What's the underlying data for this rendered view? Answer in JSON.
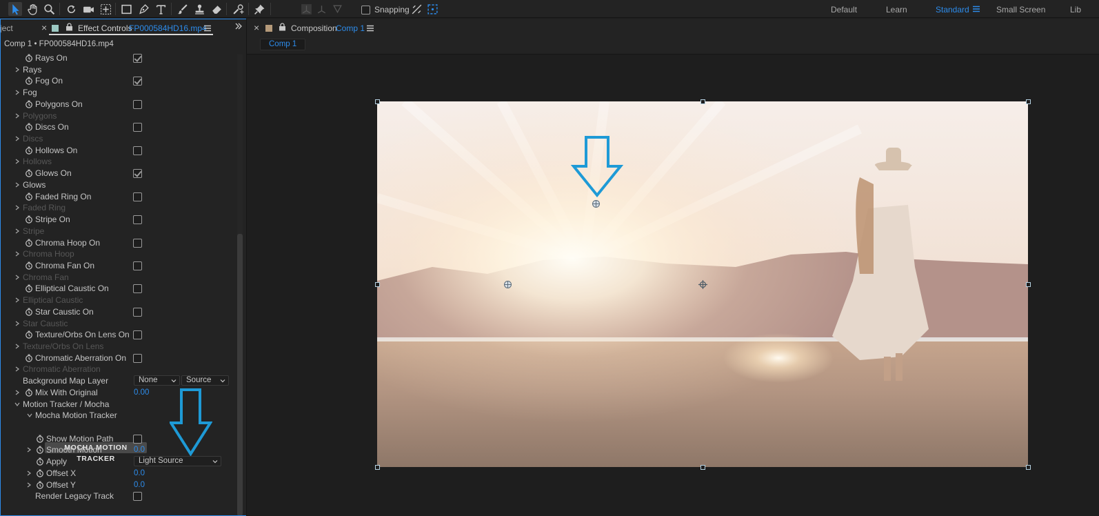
{
  "toolbar": {
    "tools": [
      "selection-tool",
      "hand-tool",
      "zoom-tool",
      "rotate-tool",
      "camera-tool",
      "pan-behind-tool",
      "rectangle-tool",
      "pen-tool",
      "type-tool",
      "brush-tool",
      "clone-stamp-tool",
      "eraser-tool",
      "roto-brush-tool",
      "puppet-pin-tool"
    ],
    "snapping_label": "Snapping",
    "snapping_checked": false,
    "workspaces": [
      "Default",
      "Learn",
      "Standard",
      "Small Screen",
      "Lib"
    ],
    "active_workspace": "Standard"
  },
  "effect_panel": {
    "project_tab_fragment": "ject",
    "tab_label": "Effect Controls",
    "tab_file": "FP000584HD16.mp4",
    "subheader": "Comp 1 • FP000584HD16.mp4",
    "rows": [
      {
        "label": "Rays On",
        "kind": "checkbox",
        "checked": true
      },
      {
        "label": "Rays",
        "kind": "group",
        "dim": false
      },
      {
        "label": "Fog On",
        "kind": "checkbox",
        "checked": true
      },
      {
        "label": "Fog",
        "kind": "group",
        "dim": false
      },
      {
        "label": "Polygons On",
        "kind": "checkbox",
        "checked": false
      },
      {
        "label": "Polygons",
        "kind": "group",
        "dim": true
      },
      {
        "label": "Discs On",
        "kind": "checkbox",
        "checked": false
      },
      {
        "label": "Discs",
        "kind": "group",
        "dim": true
      },
      {
        "label": "Hollows On",
        "kind": "checkbox",
        "checked": false
      },
      {
        "label": "Hollows",
        "kind": "group",
        "dim": true
      },
      {
        "label": "Glows On",
        "kind": "checkbox",
        "checked": true
      },
      {
        "label": "Glows",
        "kind": "group",
        "dim": false
      },
      {
        "label": "Faded Ring On",
        "kind": "checkbox",
        "checked": false
      },
      {
        "label": "Faded Ring",
        "kind": "group",
        "dim": true
      },
      {
        "label": "Stripe On",
        "kind": "checkbox",
        "checked": false
      },
      {
        "label": "Stripe",
        "kind": "group",
        "dim": true
      },
      {
        "label": "Chroma Hoop On",
        "kind": "checkbox",
        "checked": false
      },
      {
        "label": "Chroma Hoop",
        "kind": "group",
        "dim": true
      },
      {
        "label": "Chroma Fan On",
        "kind": "checkbox",
        "checked": false
      },
      {
        "label": "Chroma Fan",
        "kind": "group",
        "dim": true
      },
      {
        "label": "Elliptical Caustic On",
        "kind": "checkbox",
        "checked": false
      },
      {
        "label": "Elliptical Caustic",
        "kind": "group",
        "dim": true
      },
      {
        "label": "Star Caustic On",
        "kind": "checkbox",
        "checked": false
      },
      {
        "label": "Star Caustic",
        "kind": "group",
        "dim": true
      },
      {
        "label": "Texture/Orbs On Lens On",
        "kind": "checkbox",
        "checked": false
      },
      {
        "label": "Texture/Orbs On Lens",
        "kind": "group",
        "dim": true
      },
      {
        "label": "Chromatic Aberration On",
        "kind": "checkbox",
        "checked": false
      },
      {
        "label": "Chromatic Aberration",
        "kind": "group",
        "dim": true
      }
    ],
    "background_map_layer": {
      "label": "Background Map Layer",
      "layer": "None",
      "source": "Source"
    },
    "mix_with_original": {
      "label": "Mix With Original",
      "value": "0.00"
    },
    "motion_tracker_group": "Motion Tracker / Mocha",
    "mocha_group": "Mocha Motion Tracker",
    "mocha_button": "MOCHA MOTION TRACKER",
    "show_motion_path": {
      "label": "Show Motion Path",
      "checked": false
    },
    "smooth_motion": {
      "label": "Smooth Motion",
      "value": "0.0"
    },
    "apply": {
      "label": "Apply",
      "value": "Light Source"
    },
    "offset_x": {
      "label": "Offset X",
      "value": "0.0"
    },
    "offset_y": {
      "label": "Offset Y",
      "value": "0.0"
    },
    "render_legacy_track": {
      "label": "Render Legacy Track",
      "checked": false
    }
  },
  "composition": {
    "tab_prefix": "Composition",
    "tab_name": "Comp 1",
    "sub_tab": "Comp 1"
  },
  "colors": {
    "accent": "#2d8ceb",
    "annotation_arrow": "#1e9ad6",
    "panel_bg": "#232323",
    "viewer_bg": "#1e1e1e"
  }
}
